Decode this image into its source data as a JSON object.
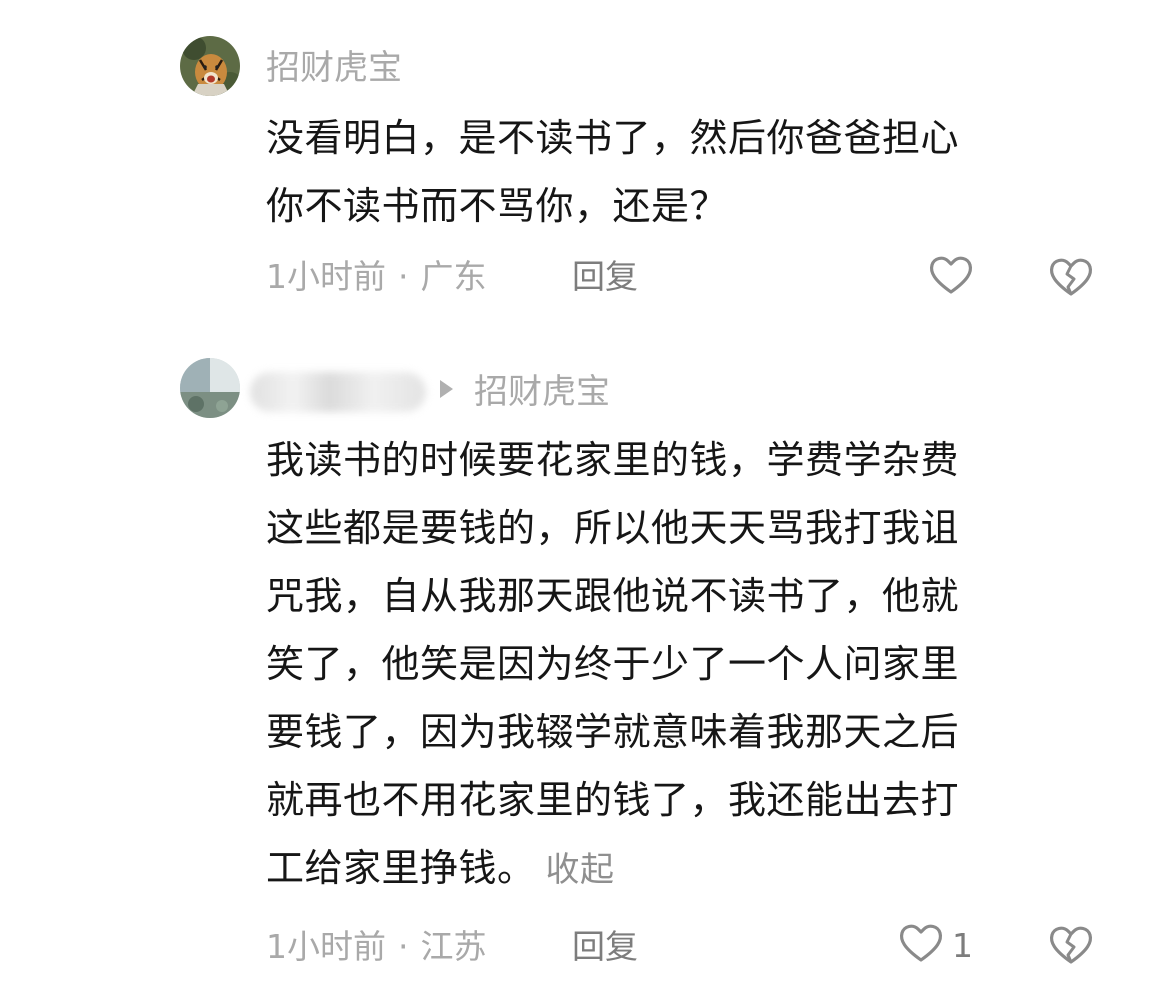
{
  "comments": [
    {
      "username": "招财虎宝",
      "lines": [
        "没看明白，是不读书了，然后你爸爸担心",
        "你不读书而不骂你，还是？"
      ],
      "time": "1小时前",
      "separator": "·",
      "location": "广东",
      "reply_label": "回复",
      "like_count": null,
      "avatar_icon": "tiger-avatar-icon"
    },
    {
      "reply_to": "招财虎宝",
      "lines": [
        "我读书的时候要花家里的钱，学费学杂费",
        "这些都是要钱的，所以他天天骂我打我诅",
        "咒我，自从我那天跟他说不读书了，他就",
        "笑了，他笑是因为终于少了一个人问家里",
        "要钱了，因为我辍学就意味着我那天之后",
        "就再也不用花家里的钱了，我还能出去打",
        "工给家里挣钱。"
      ],
      "collapse_label": "收起",
      "time": "1小时前",
      "separator": "·",
      "location": "江苏",
      "reply_label": "回复",
      "like_count": "1",
      "avatar_icon": "blurred-avatar-icon"
    }
  ],
  "colors": {
    "text": "#161616",
    "muted": "#a9a9a9",
    "action": "#7d7d7d",
    "icon_stroke": "#8a8a8a"
  }
}
